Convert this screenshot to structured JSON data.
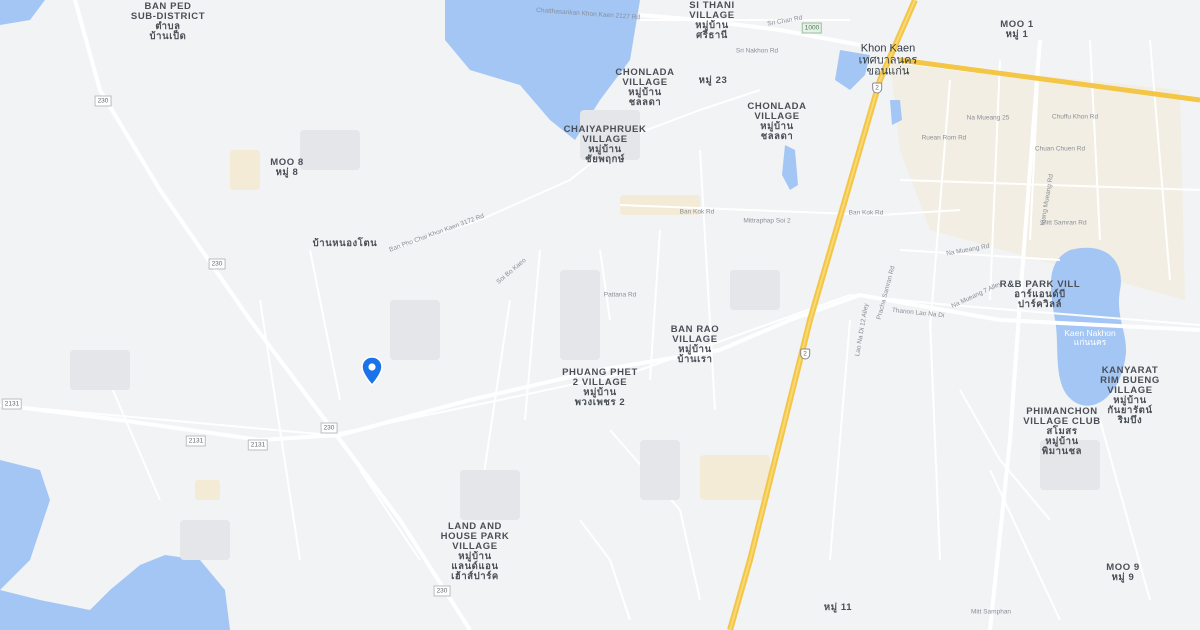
{
  "map": {
    "colors": {
      "background": "#f2f3f5",
      "water": "#a3c6f5",
      "minor_road": "#ffffff",
      "highway": "#f3c646",
      "urban": "#f4ead0",
      "pin": "#1a73e8"
    },
    "marker": {
      "icon": "map-pin-icon"
    },
    "places": [
      "BAN PED\nSUB-DISTRICT\nตำบล\nบ้านเป็ด",
      "SI THANI\nVILLAGE\nหมู่บ้าน\nศรีธานี",
      "CHONLADA\nVILLAGE\nหมู่บ้าน\nชลลดา",
      "หมู่ 23",
      "CHONLADA\nVILLAGE\nหมู่บ้าน\nชลลดา",
      "CHAIYAPHRUEK\nVILLAGE\nหมู่บ้าน\nชัยพฤกษ์",
      "MOO 8\nหมู่ 8",
      "บ้านหนองโตน",
      "BAN RAO\nVILLAGE\nหมู่บ้าน\nบ้านเรา",
      "PHUANG PHET\n2 VILLAGE\nหมู่บ้าน\nพวงเพชร 2",
      "LAND AND\nHOUSE PARK\nVILLAGE\nหมู่บ้าน\nแลนด์แอน\nเฮ้าส์ปาร์ค",
      "MOO 1\nหมู่ 1",
      "R&B PARK VILL\nอาร์แอนด์บี\nปาร์ควิลล์",
      "KANYARAT\nRIM BUENG\nVILLAGE\nหมู่บ้าน\nกันยารัตน์\nริมบึง",
      "PHIMANCHON\nVILLAGE CLUB\nสโมสร\nหมู่บ้าน\nพิมานชล",
      "MOO 9\nหมู่ 9",
      "หมู่ 11"
    ],
    "city": "Khon Kaen\nเทศบาลนคร\nขอนแก่น",
    "water_label": "Kaen Nakhon\nแก่นนคร",
    "roads": [
      "Chatthasarikan Khon Kaen 2127 Rd",
      "Sri Chan Rd",
      "Sri Nakhon Rd",
      "Ban Kok Rd",
      "Thanon Lao Na Di",
      "Mittraphap Soi 2",
      "Ban Kok Rd",
      "Ban Pho Chai Khon Kaen 3172 Rd",
      "Soi Bo Kaeo",
      "Na Mueang Rd",
      "Klang Mueang Rd",
      "Mitt Samran Rd",
      "Ruean Rom Rd",
      "Na Mueang 25",
      "Chuffu Khon Rd",
      "Chuan Chuen Rd",
      "Pracha Samran Rd",
      "Lao Na Di 12 Alley",
      "Na Mueang 7 Alley",
      "Pattana Rd",
      "Mitt Samphan"
    ],
    "shields": [
      "2",
      "2",
      "230",
      "230",
      "230",
      "2131",
      "2131",
      "2131",
      "230",
      "1000"
    ]
  }
}
